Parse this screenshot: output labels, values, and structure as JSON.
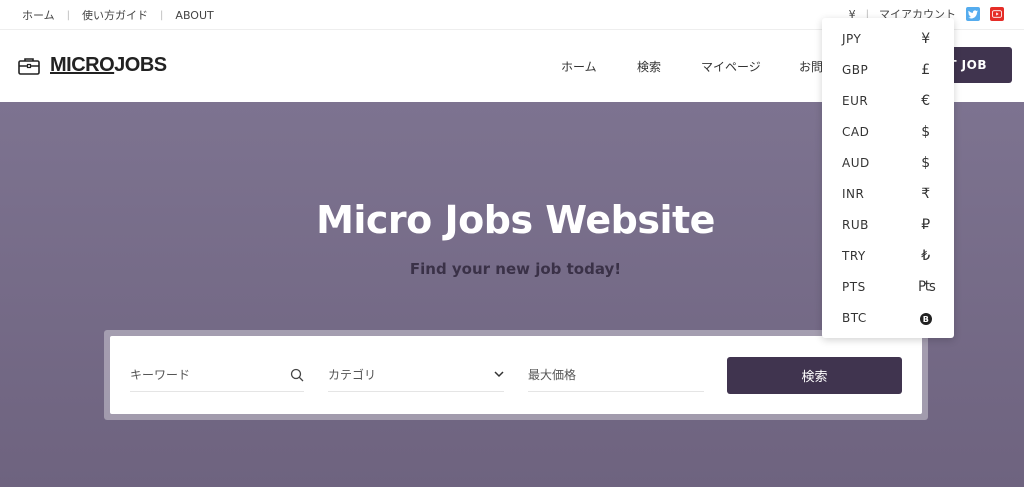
{
  "topbar": {
    "links": [
      "ホーム",
      "使い方ガイド",
      "ABOUT"
    ],
    "currency_symbol": "¥",
    "account": "マイアカウント"
  },
  "logo": {
    "part1": "MICRO",
    "part2": "JOBS"
  },
  "nav": {
    "items": [
      "ホーム",
      "検索",
      "マイページ",
      "お問"
    ],
    "post_job": "T JOB"
  },
  "hero": {
    "title": "Micro Jobs Website",
    "subtitle": "Find your new job today!"
  },
  "search": {
    "keyword_placeholder": "キーワード",
    "category_placeholder": "カテゴリ",
    "max_price_placeholder": "最大価格",
    "button": "検索"
  },
  "currency_menu": [
    {
      "code": "JPY",
      "symbol": "¥"
    },
    {
      "code": "GBP",
      "symbol": "£"
    },
    {
      "code": "EUR",
      "symbol": "€"
    },
    {
      "code": "CAD",
      "symbol": "$"
    },
    {
      "code": "AUD",
      "symbol": "$"
    },
    {
      "code": "INR",
      "symbol": "₹"
    },
    {
      "code": "RUB",
      "symbol": "₽"
    },
    {
      "code": "TRY",
      "symbol": "₺"
    },
    {
      "code": "PTS",
      "symbol": "₧"
    },
    {
      "code": "BTC",
      "symbol": "B"
    }
  ],
  "colors": {
    "brand": "#40344f",
    "hero": "#7d7390",
    "twitter": "#55acee",
    "youtube": "#e52d27"
  }
}
